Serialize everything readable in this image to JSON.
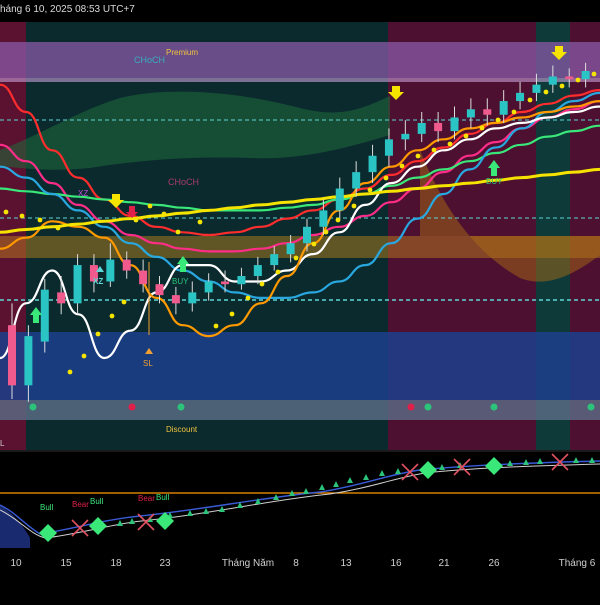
{
  "header": {
    "timestamp": "háng 6 10, 2025 08:53 UTC+7"
  },
  "zones": {
    "premium": "Premium",
    "discount": "Discount",
    "choch_top": "CHoCH",
    "choch_mid": "CHoCH"
  },
  "signals": {
    "xz_upper": "XZ",
    "xz_lower": "XZ",
    "buy_1": "BUY",
    "buy_2": "BUY",
    "sl": "SL",
    "left_mark": "SL",
    "bottom_left": "L"
  },
  "oscillator": {
    "labels": [
      "Bull",
      "Bear",
      "Bull",
      "Bear",
      "Bull"
    ]
  },
  "x_axis": {
    "ticks": [
      "10",
      "15",
      "18",
      "23",
      "Tháng Năm",
      "8",
      "13",
      "16",
      "21",
      "26",
      "Tháng 6"
    ]
  },
  "colors": {
    "bull_candle": "#2bc4c4",
    "bear_candle": "#f05a8c",
    "premium_band": "#8a5aa8",
    "discount_band": "#1c3f8c",
    "red_zone": "#5a1230",
    "teal_zone": "#0e3a3a",
    "sar_dot": "#f5e300",
    "orange_line": "#ff9900"
  },
  "chart_data": {
    "type": "line",
    "title": "",
    "xlabel": "",
    "ylabel": "",
    "x": [
      "10",
      "15",
      "18",
      "23",
      "Tháng Năm",
      "8",
      "13",
      "16",
      "21",
      "26",
      "Tháng 6"
    ],
    "candles": [
      {
        "o": 62,
        "c": 40,
        "h": 70,
        "l": 35
      },
      {
        "o": 40,
        "c": 58,
        "h": 62,
        "l": 34
      },
      {
        "o": 56,
        "c": 75,
        "h": 79,
        "l": 52
      },
      {
        "o": 74,
        "c": 70,
        "h": 80,
        "l": 66
      },
      {
        "o": 70,
        "c": 84,
        "h": 88,
        "l": 66
      },
      {
        "o": 84,
        "c": 78,
        "h": 88,
        "l": 74
      },
      {
        "o": 78,
        "c": 86,
        "h": 92,
        "l": 76
      },
      {
        "o": 86,
        "c": 82,
        "h": 89,
        "l": 79
      },
      {
        "o": 82,
        "c": 77,
        "h": 86,
        "l": 74
      },
      {
        "o": 77,
        "c": 73,
        "h": 80,
        "l": 70
      },
      {
        "o": 73,
        "c": 70,
        "h": 76,
        "l": 66
      },
      {
        "o": 70,
        "c": 74,
        "h": 78,
        "l": 67
      },
      {
        "o": 74,
        "c": 78,
        "h": 81,
        "l": 71
      },
      {
        "o": 78,
        "c": 77,
        "h": 82,
        "l": 74
      },
      {
        "o": 77,
        "c": 80,
        "h": 83,
        "l": 75
      },
      {
        "o": 80,
        "c": 84,
        "h": 87,
        "l": 77
      },
      {
        "o": 84,
        "c": 88,
        "h": 91,
        "l": 82
      },
      {
        "o": 88,
        "c": 92,
        "h": 95,
        "l": 85
      },
      {
        "o": 92,
        "c": 98,
        "h": 101,
        "l": 89
      },
      {
        "o": 98,
        "c": 104,
        "h": 108,
        "l": 95
      },
      {
        "o": 104,
        "c": 112,
        "h": 116,
        "l": 101
      },
      {
        "o": 112,
        "c": 118,
        "h": 122,
        "l": 109
      },
      {
        "o": 118,
        "c": 124,
        "h": 128,
        "l": 114
      },
      {
        "o": 124,
        "c": 130,
        "h": 134,
        "l": 120
      },
      {
        "o": 130,
        "c": 132,
        "h": 137,
        "l": 126
      },
      {
        "o": 132,
        "c": 136,
        "h": 140,
        "l": 129
      },
      {
        "o": 136,
        "c": 133,
        "h": 140,
        "l": 129
      },
      {
        "o": 133,
        "c": 138,
        "h": 142,
        "l": 130
      },
      {
        "o": 138,
        "c": 141,
        "h": 145,
        "l": 134
      },
      {
        "o": 141,
        "c": 139,
        "h": 145,
        "l": 135
      },
      {
        "o": 139,
        "c": 144,
        "h": 148,
        "l": 136
      },
      {
        "o": 144,
        "c": 147,
        "h": 151,
        "l": 141
      },
      {
        "o": 147,
        "c": 150,
        "h": 154,
        "l": 144
      },
      {
        "o": 150,
        "c": 153,
        "h": 157,
        "l": 147
      },
      {
        "o": 153,
        "c": 152,
        "h": 156,
        "l": 149
      },
      {
        "o": 152,
        "c": 155,
        "h": 158,
        "l": 149
      }
    ],
    "series": [
      {
        "color": "#ff2d2d",
        "values": [
          150,
          140,
          126,
          116,
          108,
          102,
          98,
          96,
          95,
          96,
          98,
          101,
          104,
          108,
          112,
          117,
          122,
          127,
          132,
          136,
          140,
          143,
          146,
          148
        ]
      },
      {
        "color": "#ff2d88",
        "values": [
          128,
          122,
          114,
          106,
          100,
          95,
          92,
          90,
          89,
          89,
          90,
          92,
          95,
          98,
          102,
          107,
          112,
          118,
          124,
          129,
          134,
          138,
          141,
          144
        ]
      },
      {
        "color": "#3ae87a",
        "values": [
          112,
          111,
          110,
          109,
          108,
          107,
          106,
          105,
          104,
          104,
          104,
          105,
          106,
          108,
          110,
          113,
          116,
          119,
          122,
          125,
          128,
          131,
          133,
          135
        ]
      },
      {
        "color": "#29a8e0",
        "values": [
          120,
          116,
          110,
          104,
          98,
          92,
          87,
          82,
          78,
          74,
          72,
          72,
          74,
          78,
          84,
          92,
          101,
          110,
          119,
          127,
          134,
          140,
          144,
          147
        ]
      },
      {
        "color": "#ffffff",
        "values": [
          50,
          70,
          82,
          66,
          50,
          60,
          74,
          84,
          84,
          78,
          78,
          82,
          88,
          96,
          106,
          114,
          120,
          126,
          130,
          134,
          136,
          138,
          140,
          142
        ]
      },
      {
        "color": "#ff9900",
        "values": [
          90,
          94,
          100,
          98,
          94,
          84,
          72,
          62,
          58,
          62,
          70,
          80,
          92,
          104,
          114,
          120,
          126,
          130,
          134,
          136,
          138,
          140,
          142,
          144
        ]
      },
      {
        "color": "#f5e300",
        "values": [
          96,
          97,
          98,
          99,
          100,
          101,
          102,
          103,
          104,
          105,
          106,
          107,
          108,
          109,
          110,
          111,
          112,
          113,
          114,
          115,
          116,
          117,
          118,
          119
        ]
      }
    ],
    "ylim": [
      20,
      170
    ],
    "grid": false
  }
}
